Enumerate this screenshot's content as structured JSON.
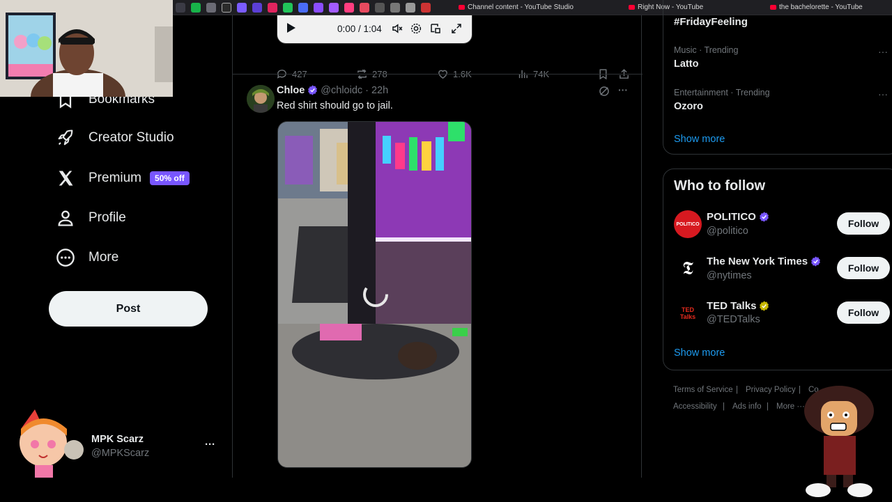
{
  "browser": {
    "tabs": [
      {
        "label": "Channel content - YouTube Studio"
      },
      {
        "label": "Right Now - YouTube"
      },
      {
        "label": "the bachelorette - YouTube"
      }
    ]
  },
  "nav": {
    "items": [
      {
        "label": "Bookmarks",
        "icon": "bookmark-icon"
      },
      {
        "label": "Creator Studio",
        "icon": "rocket-icon"
      },
      {
        "label": "Premium",
        "icon": "x-logo-icon",
        "badge": "50% off"
      },
      {
        "label": "Profile",
        "icon": "person-icon"
      },
      {
        "label": "More",
        "icon": "more-circle-icon"
      }
    ],
    "post_label": "Post",
    "account": {
      "name": "MPK Scarz",
      "handle": "@MPKScarz",
      "menu": "···"
    }
  },
  "prev_tweet": {
    "video_time": "0:00 / 1:04",
    "replies": "427",
    "reposts": "278",
    "likes": "1.6K",
    "views": "74K"
  },
  "tweet": {
    "name": "Chloe",
    "handle": "@chloidc",
    "separator": "·",
    "time": "22h",
    "text": "Red shirt should go to jail.",
    "menu": "···"
  },
  "trends": [
    {
      "category": "",
      "name": "#FridayFeeling"
    },
    {
      "category": "Music · Trending",
      "name": "Latto"
    },
    {
      "category": "Entertainment · Trending",
      "name": "Ozoro"
    }
  ],
  "trends_show_more": "Show more",
  "who_to_follow": {
    "title": "Who to follow",
    "accounts": [
      {
        "name": "POLITICO",
        "handle": "@politico",
        "button": "Follow",
        "verified_color": "#7856ff",
        "avatar_text": "POLITICO"
      },
      {
        "name": "The New York Times",
        "handle": "@nytimes",
        "button": "Follow",
        "verified_color": "#7856ff",
        "avatar_text": "𝕿"
      },
      {
        "name": "TED Talks",
        "handle": "@TEDTalks",
        "button": "Follow",
        "verified_color": "#c8b800",
        "avatar_text": "TED Talks"
      }
    ],
    "show_more": "Show more"
  },
  "footer": {
    "terms": "Terms of Service",
    "privacy": "Privacy Policy",
    "cookie": "Co",
    "accessibility": "Accessibility",
    "ads": "Ads info",
    "more": "More ···"
  },
  "colors": {
    "accent": "#1d9bf0",
    "premium": "#7856ff",
    "bg": "#000000"
  }
}
